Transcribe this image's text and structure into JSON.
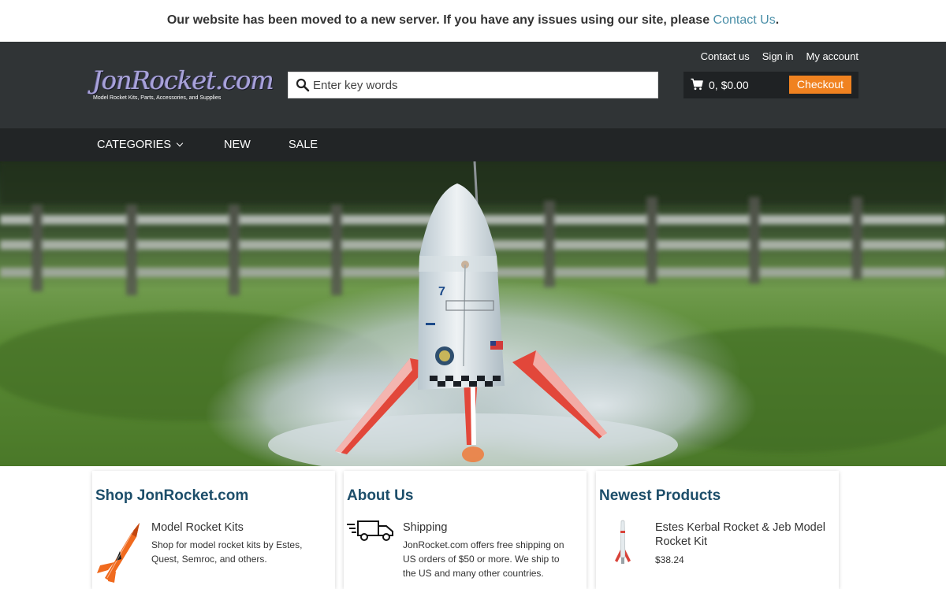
{
  "notice": {
    "text": "Our website has been moved to a new server. If you have any issues using our site, please ",
    "link": "Contact Us",
    "end": "."
  },
  "header": {
    "logo_text": "JonRocket.com",
    "logo_tagline": "Model Rocket Kits, Parts, Accessories, and Supplies",
    "search_placeholder": "Enter key words",
    "links": {
      "contact": "Contact us",
      "signin": "Sign in",
      "account": "My account"
    },
    "cart": {
      "summary": "0, $0.00",
      "checkout": "Checkout"
    }
  },
  "nav": {
    "categories": "CATEGORIES",
    "new": "NEW",
    "sale": "SALE"
  },
  "sections": {
    "shop": {
      "title": "Shop JonRocket.com",
      "item_title": "Model Rocket Kits",
      "item_desc": "Shop for model rocket kits by Estes, Quest, Semroc, and others."
    },
    "about": {
      "title": "About Us",
      "item_title": "Shipping",
      "item_desc": "JonRocket.com offers free shipping on US orders of $50 or more. We ship to the US and many other countries."
    },
    "newest": {
      "title": "Newest Products",
      "item_title": "Estes Kerbal Rocket & Jeb Model Rocket Kit",
      "item_price": "$38.24"
    }
  },
  "colors": {
    "header_bg": "#303436",
    "nav_bg": "#222526",
    "checkout_orange": "#f08220",
    "link_teal": "#4a8fa8",
    "section_title": "#1d4e6a"
  }
}
